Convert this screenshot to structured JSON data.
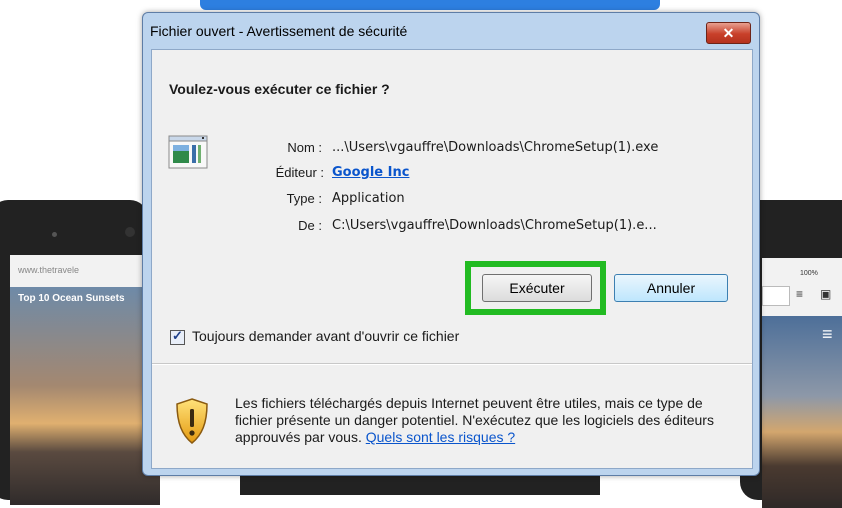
{
  "background": {
    "left_device_url": "www.thetravele",
    "left_device_title": "Top 10 Ocean Sunsets",
    "right_device_zoom": "100%"
  },
  "dialog": {
    "title": "Fichier ouvert - Avertissement de sécurité",
    "close_label": "✕",
    "question": "Voulez-vous exécuter ce fichier ?",
    "fields": {
      "name_label": "Nom :",
      "name_value": "...\\Users\\vgauffre\\Downloads\\ChromeSetup(1).exe",
      "publisher_label": "Éditeur :",
      "publisher_value": "Google Inc",
      "type_label": "Type :",
      "type_value": "Application",
      "from_label": "De :",
      "from_value": "C:\\Users\\vgauffre\\Downloads\\ChromeSetup(1).e..."
    },
    "buttons": {
      "run": "Exécuter",
      "cancel": "Annuler"
    },
    "checkbox": {
      "label": "Toujours demander avant d'ouvrir ce fichier",
      "checked": true
    },
    "warning": {
      "text": "Les fichiers téléchargés depuis Internet peuvent être utiles, mais ce type de fichier présente un danger potentiel. N'exécutez que les logiciels des éditeurs approuvés par vous. ",
      "link": "Quels sont les risques ?"
    }
  },
  "colors": {
    "highlight": "#22bb22",
    "link": "#0a55cc",
    "close_button": "#c8402a"
  }
}
